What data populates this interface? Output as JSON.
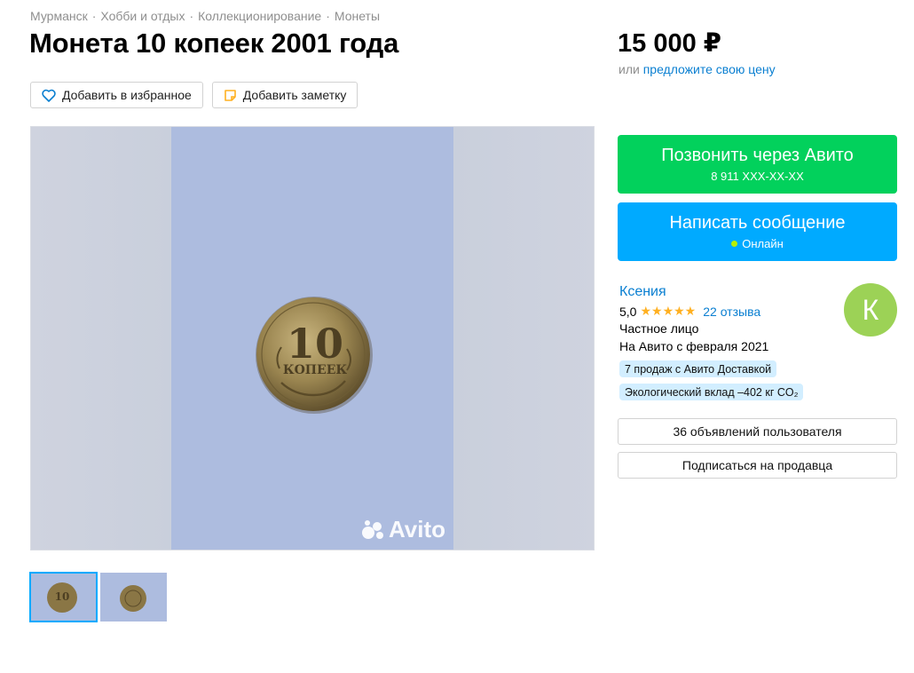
{
  "breadcrumb": [
    "Мурманск",
    "Хобби и отдых",
    "Коллекционирование",
    "Монеты"
  ],
  "breadcrumb_separator": "·",
  "title": "Монета 10 копеек 2001 года",
  "actions": {
    "favorite_label": "Добавить в избранное",
    "note_label": "Добавить заметку"
  },
  "gallery": {
    "watermark": "Avito",
    "coin_denomination": "10",
    "coin_text": "КОПЕЕК",
    "thumbnail_count": 2,
    "active_thumbnail": 1
  },
  "price": {
    "value": "15 000 ₽",
    "offer_prefix": "или",
    "offer_link": "предложите свою цену"
  },
  "call": {
    "label": "Позвонить через Авито",
    "phone": "8 911 XXX-XX-XX"
  },
  "message": {
    "label": "Написать сообщение",
    "status": "Онлайн"
  },
  "seller": {
    "name": "Ксения",
    "rating": "5,0",
    "stars": "★★★★★",
    "reviews": "22 отзыва",
    "type": "Частное лицо",
    "since": "На Авито с февраля 2021",
    "badge_delivery": "7 продаж с Авито Доставкой",
    "badge_eco": "Экологический вклад –402 кг CO₂",
    "avatar_letter": "К"
  },
  "buttons": {
    "listings": "36 объявлений пользователя",
    "subscribe": "Подписаться на продавца"
  },
  "colors": {
    "call_green": "#02d15c",
    "message_blue": "#00aaff",
    "link_blue": "#0a7fd1",
    "avatar_green": "#9cd256",
    "star_orange": "#ffb021"
  }
}
